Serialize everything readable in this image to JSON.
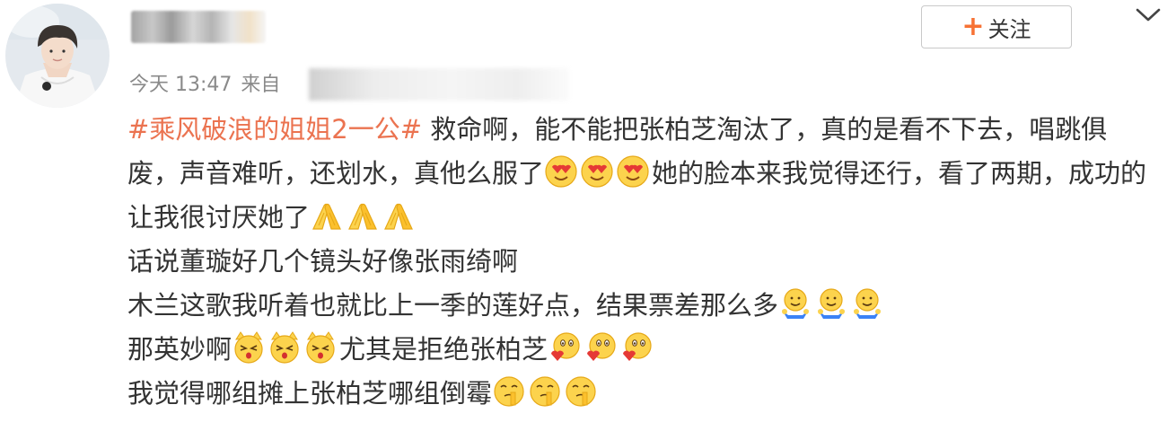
{
  "post": {
    "meta": {
      "time": "今天 13:47",
      "source_prefix": "来自"
    },
    "follow_button": {
      "label": "关注",
      "plus": "+"
    },
    "content": {
      "topic": "#乘风破浪的姐姐2一公#",
      "line1_text": " 救命啊，能不能把张柏芝淘汰了，真的是看不下去，唱跳俱废，声音难听，还划水，真他么服了",
      "line1_after_emoji": "她的脸本来我觉得还行，看了两期，成功的让我很讨厌她了",
      "line2": "话说董璇好几个镜头好像张雨绮啊",
      "line3": "木兰这歌我听着也就比上一季的莲好点，结果票差那么多",
      "line4_before": "那英妙啊",
      "line4_after": "尤其是拒绝张柏芝",
      "line5": "我觉得哪组摊上张柏芝哪组倒霉"
    },
    "emoji_names": {
      "love_eyes": "heart-eyes-emoji",
      "clap": "clap-emoji",
      "spread_hands": "spread-hands-emoji",
      "cat_face": "cat-face-emoji",
      "heart_hug": "heart-hug-emoji",
      "shush": "shush-emoji"
    },
    "colors": {
      "topic": "#eb7350",
      "text": "#333333",
      "meta": "#8a8a8a",
      "follow_plus": "#f77234"
    }
  }
}
